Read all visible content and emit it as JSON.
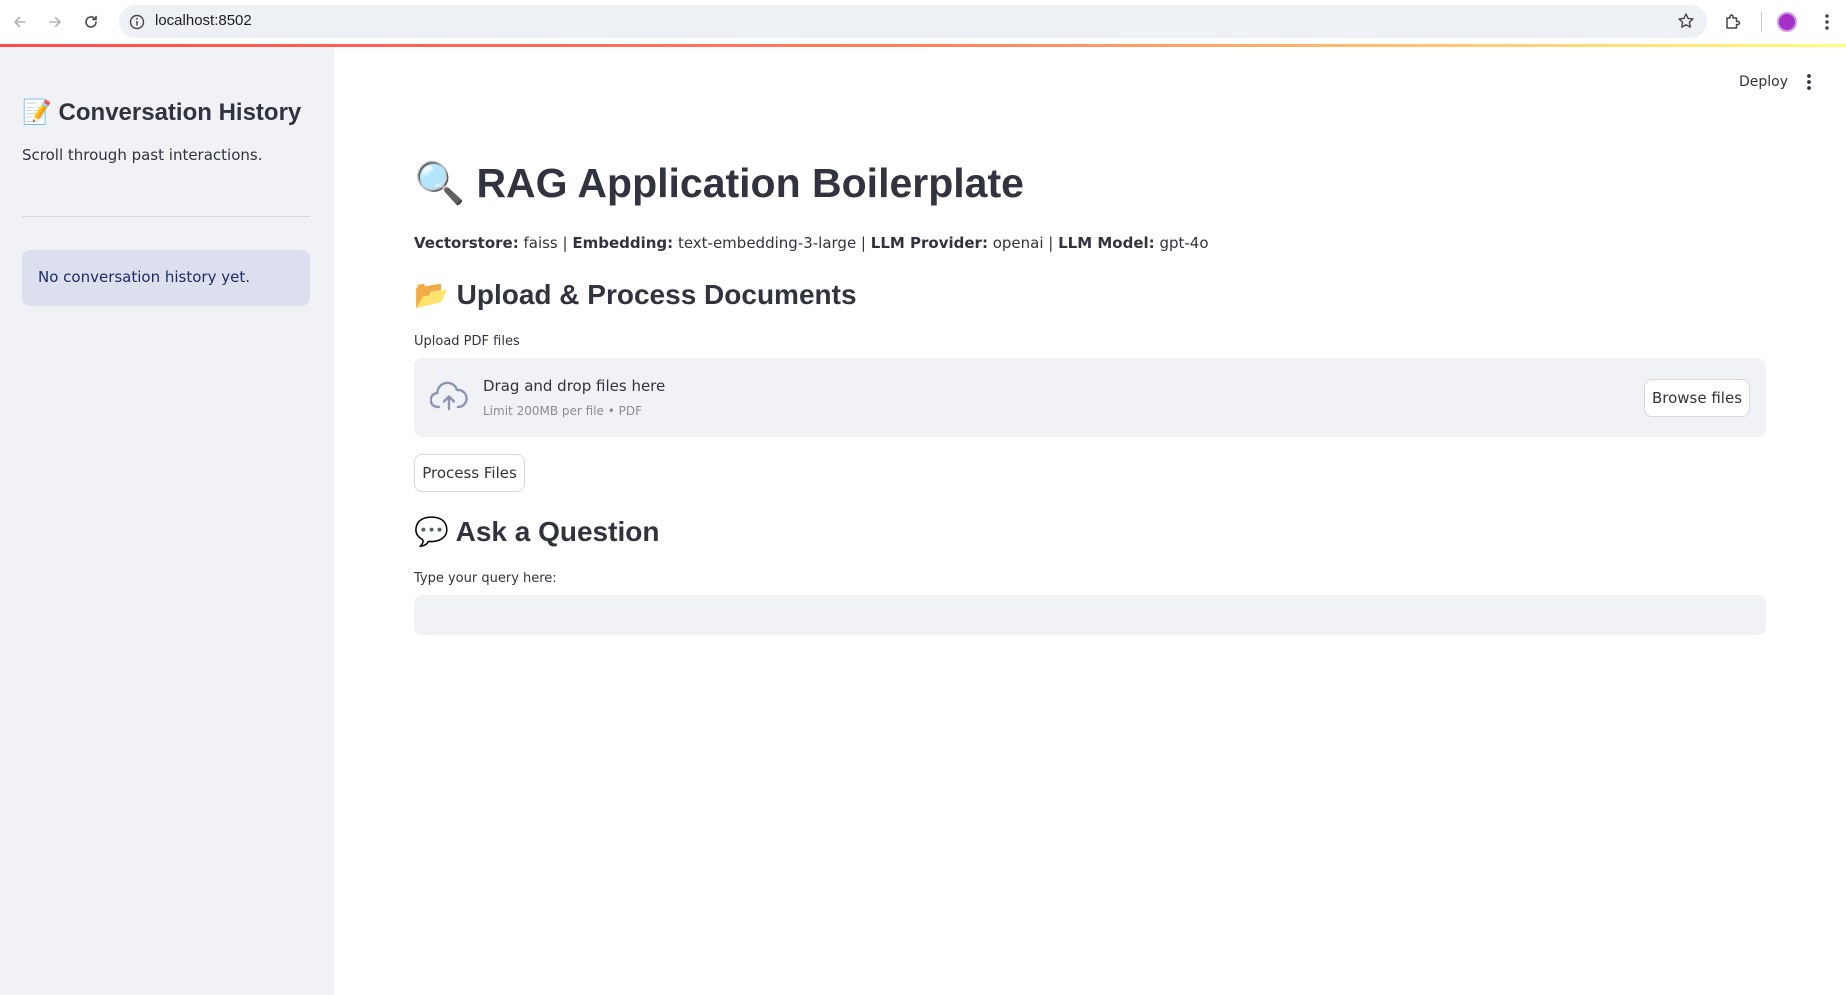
{
  "browser": {
    "url": "localhost:8502"
  },
  "sidebar": {
    "title": "📝 Conversation History",
    "subtitle": "Scroll through past interactions.",
    "info": "No conversation history yet."
  },
  "header": {
    "deploy_label": "Deploy"
  },
  "main": {
    "title": "🔍 RAG Application Boilerplate",
    "meta": {
      "vectorstore_label": "Vectorstore:",
      "vectorstore_value": " faiss | ",
      "embedding_label": "Embedding:",
      "embedding_value": " text-embedding-3-large | ",
      "provider_label": "LLM Provider:",
      "provider_value": " openai | ",
      "model_label": "LLM Model:",
      "model_value": " gpt-4o"
    },
    "upload_heading": "📂 Upload & Process Documents",
    "upload_label": "Upload PDF files",
    "dropzone_title": "Drag and drop files here",
    "dropzone_sub": "Limit 200MB per file • PDF",
    "browse_label": "Browse files",
    "process_label": "Process Files",
    "ask_heading": "💬 Ask a Question",
    "query_label": "Type your query here:",
    "query_value": ""
  },
  "colors": {
    "sidebar_bg": "#f0f2f6",
    "info_bg": "#dce0ee",
    "text": "#31333f",
    "accent_gradient_start": "#ff4b4b",
    "accent_gradient_end": "#fffd80"
  },
  "icons": [
    "back-arrow-icon",
    "forward-arrow-icon",
    "reload-icon",
    "site-info-icon",
    "bookmark-star-icon",
    "extensions-icon",
    "profile-avatar",
    "chrome-menu-icon",
    "streamlit-menu-icon",
    "cloud-upload-icon"
  ]
}
